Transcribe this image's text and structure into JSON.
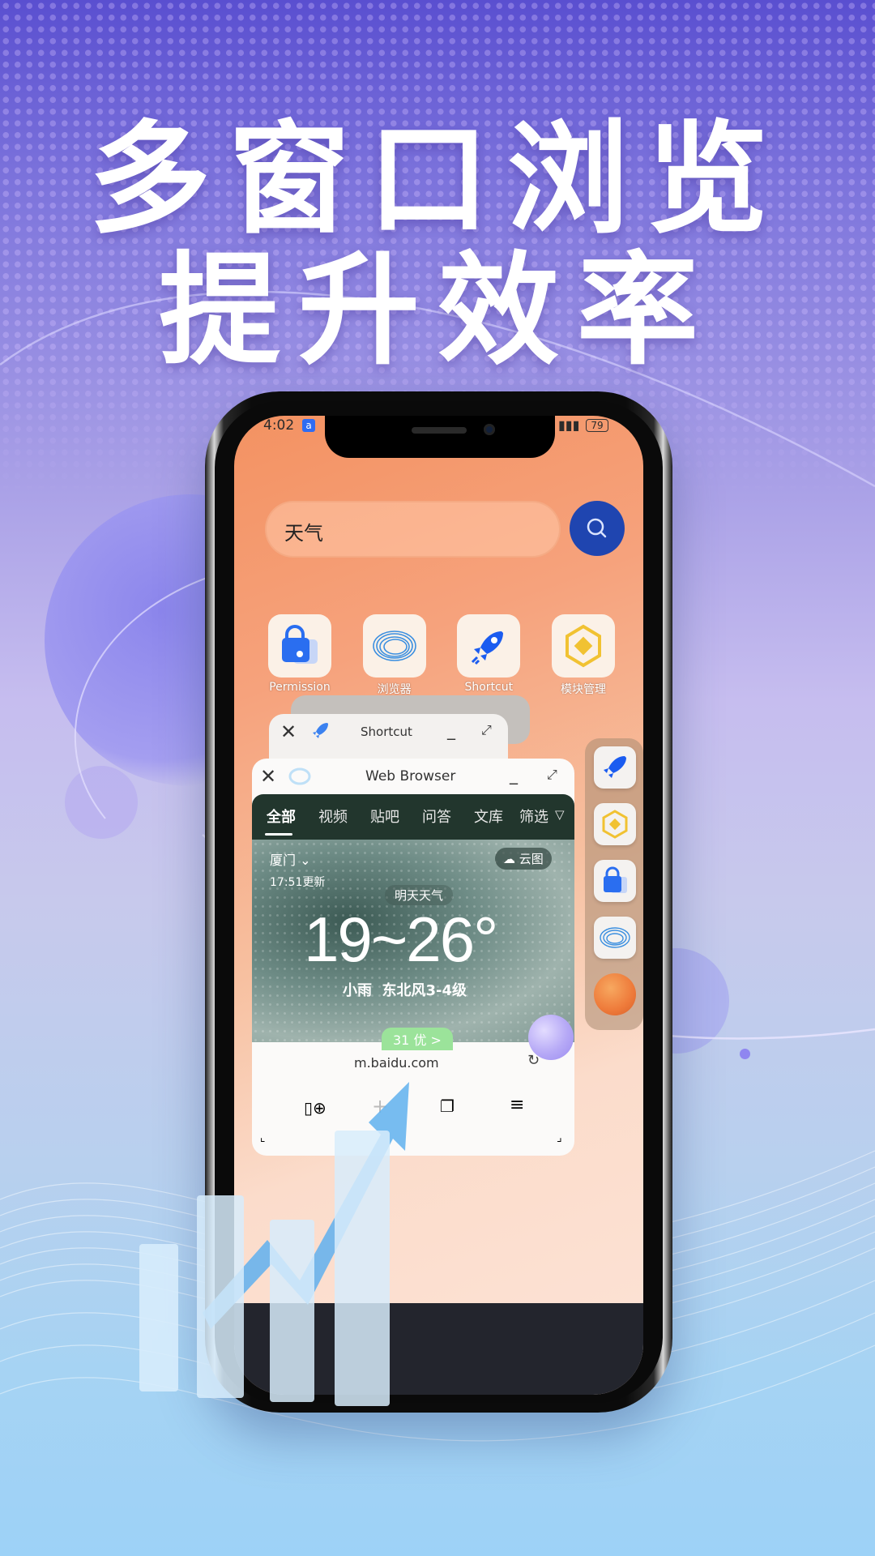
{
  "headline": {
    "line1": "多窗口浏览",
    "line2": "提升效率"
  },
  "status_bar": {
    "time": "4:02",
    "battery": "79",
    "signal_icon": "signal-icon"
  },
  "search": {
    "value": "天气",
    "button_icon": "search-icon"
  },
  "apps": [
    {
      "label": "Permission",
      "icon": "lock-bag-icon"
    },
    {
      "label": "浏览器",
      "icon": "browser-swirl-icon"
    },
    {
      "label": "Shortcut",
      "icon": "rocket-icon"
    },
    {
      "label": "模块管理",
      "icon": "puzzle-module-icon"
    }
  ],
  "windows": {
    "shortcut": {
      "title": "Shortcut",
      "close_icon": "close-icon",
      "minimize_icon": "minimize-icon",
      "maximize_icon": "maximize-icon"
    },
    "web_browser": {
      "title": "Web Browser",
      "tabs": [
        "全部",
        "视频",
        "贴吧",
        "问答",
        "文库",
        "筛选"
      ],
      "active_tab": "全部",
      "weather": {
        "city": "厦门",
        "cloud_map": "云图",
        "updated": "17:51更新",
        "label": "明天天气",
        "temperature": "19~26°",
        "condition": "小雨  东北风3-4级",
        "aqi": "31 优 >"
      },
      "url": "m.baidu.com",
      "toolbar": [
        "add-page-icon",
        "plus-icon",
        "tabs-icon",
        "menu-icon"
      ]
    }
  },
  "dock": {
    "items": [
      "rocket-icon",
      "puzzle-module-icon",
      "lock-bag-icon",
      "browser-swirl-icon",
      "orb-icon"
    ]
  },
  "colors": {
    "accent_blue": "#1f45b0",
    "tab_bar": "#22362d",
    "aqi_green": "#9be39a"
  }
}
